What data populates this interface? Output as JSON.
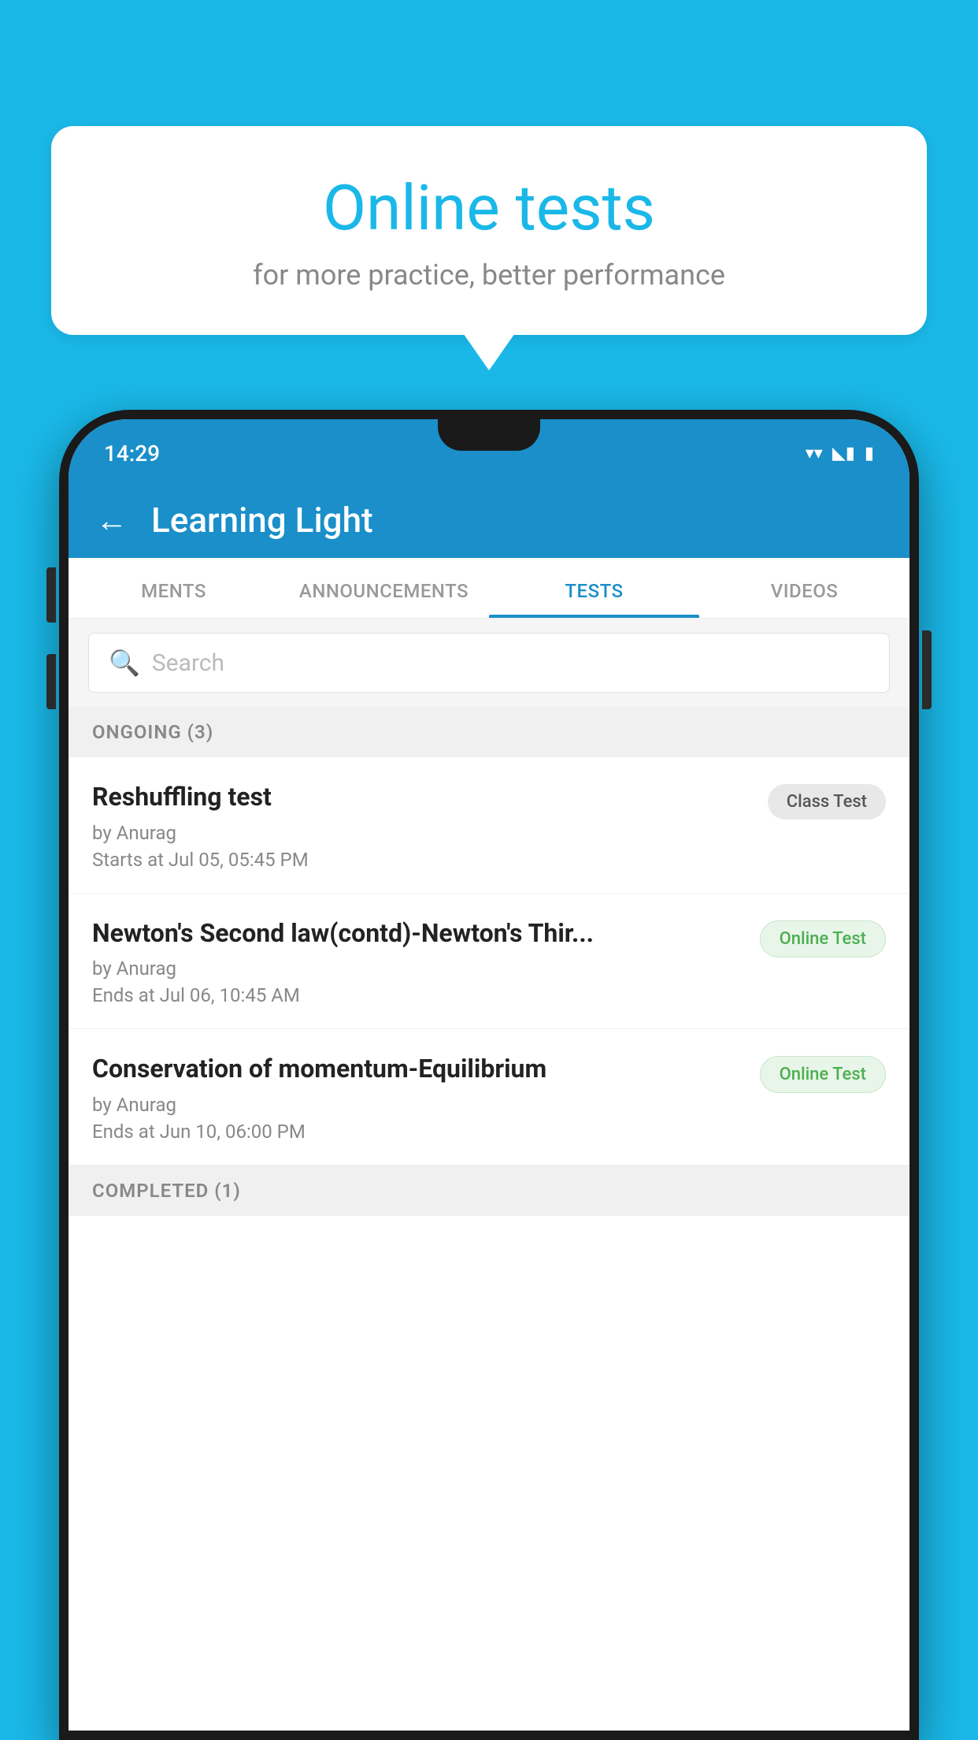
{
  "background": {
    "color": "#1ab8e8"
  },
  "speech_bubble": {
    "title": "Online tests",
    "subtitle": "for more practice, better performance"
  },
  "status_bar": {
    "time": "14:29",
    "wifi_icon": "▼",
    "signal_icon": "▲",
    "battery_icon": "▮"
  },
  "app_bar": {
    "back_label": "←",
    "title": "Learning Light"
  },
  "tabs": [
    {
      "label": "MENTS",
      "active": false
    },
    {
      "label": "ANNOUNCEMENTS",
      "active": false
    },
    {
      "label": "TESTS",
      "active": true
    },
    {
      "label": "VIDEOS",
      "active": false
    }
  ],
  "search": {
    "placeholder": "Search",
    "icon": "🔍"
  },
  "ongoing_section": {
    "label": "ONGOING (3)"
  },
  "tests": [
    {
      "name": "Reshuffling test",
      "author": "by Anurag",
      "date": "Starts at  Jul 05, 05:45 PM",
      "badge": "Class Test",
      "badge_type": "class"
    },
    {
      "name": "Newton's Second law(contd)-Newton's Thir...",
      "author": "by Anurag",
      "date": "Ends at  Jul 06, 10:45 AM",
      "badge": "Online Test",
      "badge_type": "online"
    },
    {
      "name": "Conservation of momentum-Equilibrium",
      "author": "by Anurag",
      "date": "Ends at  Jun 10, 06:00 PM",
      "badge": "Online Test",
      "badge_type": "online"
    }
  ],
  "completed_section": {
    "label": "COMPLETED (1)"
  }
}
